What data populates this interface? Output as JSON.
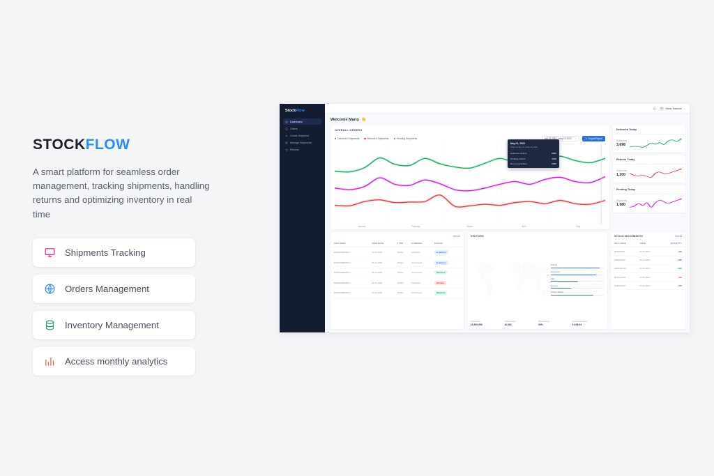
{
  "marketing": {
    "brand": {
      "first": "STOCK",
      "second": "FLOW",
      "accent": "#2e8bff"
    },
    "tagline": "A smart platform for seamless order management, tracking shipments, handling returns and optimizing inventory in real time",
    "features": [
      {
        "label": "Shipments Tracking",
        "icon": "monitor-icon",
        "color": "#e5399b"
      },
      {
        "label": "Orders Management",
        "icon": "globe-icon",
        "color": "#2e8bff"
      },
      {
        "label": "Inventory Management",
        "icon": "database-icon",
        "color": "#1fa85e"
      },
      {
        "label": "Access monthly analytics",
        "icon": "bar-chart-icon",
        "color": "#f4685f"
      }
    ]
  },
  "dashboard": {
    "sidebar": {
      "logo": {
        "first": "Stock",
        "second": "Flow"
      },
      "items": [
        {
          "label": "Dashboard",
          "icon": "home-icon",
          "active": true
        },
        {
          "label": "Orders",
          "icon": "clipboard-icon",
          "active": false
        },
        {
          "label": "Create Shipment",
          "icon": "plus-icon",
          "active": false
        },
        {
          "label": "Manage Shipments",
          "icon": "edit-icon",
          "active": false
        },
        {
          "label": "Returns",
          "icon": "return-arrow-icon",
          "active": false
        }
      ]
    },
    "topbar": {
      "bell_icon": "bell-icon",
      "avatar_initials": "MS",
      "user_name": "Mario Sassine",
      "caret": "⌄"
    },
    "welcome": {
      "text": "Welcome Mario",
      "emoji": "👋"
    },
    "chart_card": {
      "title": "OVERALL ORDERS",
      "date_range": "Jan 01 2023  -  May 01 2023",
      "export_label": "Export Report",
      "export_icon": "download-icon",
      "legend": [
        {
          "label": "Delivered Shipments",
          "color": "#1fa85e"
        },
        {
          "label": "Returned Shipments",
          "color": "#f5333f"
        },
        {
          "label": "Pending Shipments",
          "color": "#d819d8"
        }
      ],
      "tooltip": {
        "date": "May 01, 2023",
        "subtitle": "Total number of orders 12,100",
        "rows": [
          {
            "label": "Delivered Orders",
            "value": "5900"
          },
          {
            "label": "Pending Orders",
            "value": "4200"
          },
          {
            "label": "Returning Orders",
            "value": "2000"
          }
        ]
      }
    },
    "stat_cards": [
      {
        "title": "Delivered Today",
        "label": "Shipments",
        "value": "3,698",
        "color": "#1fa85e"
      },
      {
        "title": "Returns Today",
        "label": "Shipments",
        "value": "1,200",
        "color": "#f5333f"
      },
      {
        "title": "Pending Today",
        "label": "Shipments",
        "value": "1,980",
        "color": "#d819d8"
      }
    ],
    "shipments_table": {
      "see_all": "See All",
      "columns": [
        "TRACKING",
        "SHIP DATE",
        "TYPE",
        "CARRIER",
        "STATUS"
      ],
      "rows": [
        {
          "tracking": "FR02208080454 0",
          "date": "01-01-2023",
          "type": "Pickup",
          "carrier": "Colissimo",
          "status": "In delivery",
          "badge": "b-indelivery"
        },
        {
          "tracking": "FR02208080454 0",
          "date": "01-01-2023",
          "type": "Pickup",
          "carrier": "Chronopost",
          "status": "In delivery",
          "badge": "b-indelivery"
        },
        {
          "tracking": "FR02208080454 0",
          "date": "01-01-2023",
          "type": "Pickup",
          "carrier": "Chronopost",
          "status": "Delivered",
          "badge": "b-delivered"
        },
        {
          "tracking": "FR02208080454 0",
          "date": "01-01-2023",
          "type": "Pickup",
          "carrier": "Colissimo",
          "status": "Blocked",
          "badge": "b-blocked"
        },
        {
          "tracking": "FR02208080454 0",
          "date": "01-01-2023",
          "type": "Pickup",
          "carrier": "Chronopost",
          "status": "Delivered",
          "badge": "b-delivered"
        }
      ]
    },
    "visitors": {
      "title": "VISITORS",
      "countries": [
        {
          "name": "France",
          "pct": 92
        },
        {
          "name": "Germany",
          "pct": 85
        },
        {
          "name": "Italy",
          "pct": 52
        },
        {
          "name": "Greece",
          "pct": 38
        },
        {
          "name": "United States",
          "pct": 80
        }
      ],
      "stats": [
        {
          "label": "Total Users",
          "value": "18,900,900"
        },
        {
          "label": "Online Users",
          "value": "10,982"
        },
        {
          "label": "Bounce Rate",
          "value": "20%"
        },
        {
          "label": "Session Duration",
          "value": "01:08:03"
        }
      ]
    },
    "stock_movements": {
      "title": "STOCK MOVEMENTS",
      "see_all": "See All",
      "columns": [
        "SKU CODE",
        "DATE",
        "QUANTITY"
      ],
      "rows": [
        {
          "sku": "NIKE20230",
          "date": "01-01-2023",
          "qty": "-390",
          "sign": "neg"
        },
        {
          "sku": "ADIDAS120",
          "date": "01-01-2023",
          "qty": "+380",
          "sign": "pos"
        },
        {
          "sku": "ADIDAS7122",
          "date": "01-01-2023",
          "qty": "+520",
          "sign": "pos"
        },
        {
          "sku": "BOSS12209",
          "date": "01-01-2023",
          "qty": "-100",
          "sign": "neg"
        },
        {
          "sku": "DANISH122",
          "date": "01-01-2023",
          "qty": "-280",
          "sign": "neg"
        }
      ]
    }
  },
  "chart_data": {
    "type": "line",
    "title": "OVERALL ORDERS",
    "xlabel": "",
    "ylabel": "",
    "grid": true,
    "legend_position": "top-left",
    "x": [
      "January",
      "February",
      "March",
      "April",
      "May"
    ],
    "xlim": [
      0,
      5
    ],
    "ylim": [
      0,
      7000
    ],
    "series": [
      {
        "name": "Delivered Shipments",
        "color": "#1fa85e",
        "values": [
          4700,
          4650,
          5050,
          5950,
          5350,
          5250,
          5900,
          5400,
          5100,
          5000,
          5450,
          5900,
          5500,
          5400,
          5800,
          6100,
          5700,
          5500,
          5900
        ]
      },
      {
        "name": "Pending Shipments",
        "color": "#d819d8",
        "values": [
          3150,
          3000,
          3300,
          4100,
          3500,
          3400,
          3900,
          3550,
          3000,
          2900,
          3150,
          3500,
          3750,
          3500,
          3950,
          4150,
          3750,
          3650,
          4200
        ]
      },
      {
        "name": "Returned Shipments",
        "color": "#f5333f",
        "values": [
          1550,
          1500,
          1900,
          2050,
          1800,
          1850,
          1900,
          2500,
          1450,
          1500,
          1650,
          1550,
          1800,
          1900,
          1700,
          2000,
          1700,
          1650,
          2000
        ]
      }
    ],
    "sparklines": [
      {
        "name": "Delivered Today",
        "color": "#1fa85e",
        "values": [
          22,
          25,
          24,
          20,
          30,
          42,
          36,
          44,
          34,
          52,
          58,
          50,
          62
        ]
      },
      {
        "name": "Returns Today",
        "color": "#f5333f",
        "values": [
          40,
          28,
          25,
          28,
          22,
          16,
          40,
          48,
          38,
          40,
          48,
          56,
          66
        ]
      },
      {
        "name": "Pending Today",
        "color": "#d819d8",
        "values": [
          20,
          26,
          40,
          30,
          44,
          20,
          44,
          58,
          50,
          40,
          48,
          56,
          64
        ]
      }
    ]
  }
}
